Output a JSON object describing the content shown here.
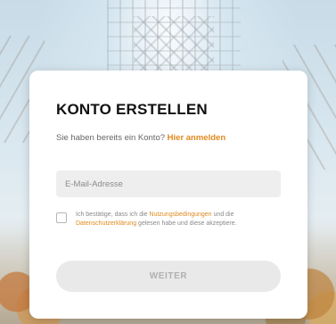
{
  "form": {
    "title": "KONTO ERSTELLEN",
    "subtitle_text": "Sie haben bereits ein Konto?",
    "login_link": "Hier anmelden",
    "email": {
      "placeholder": "E-Mail-Adresse",
      "value": ""
    },
    "consent": {
      "checked": false,
      "text_before": "Ich bestätige, dass ich die",
      "terms_link": "Nutzungsbedingungen",
      "text_middle": "und die",
      "privacy_link": "Datenschutzerklärung",
      "text_after": "gelesen habe und diese akzeptiere."
    },
    "submit_label": "WEITER"
  },
  "colors": {
    "accent": "#e08a1e",
    "card": "#ffffff",
    "input_bg": "#eeeeee",
    "button_bg": "#e9e9e9",
    "button_text": "#b0b0b0"
  }
}
